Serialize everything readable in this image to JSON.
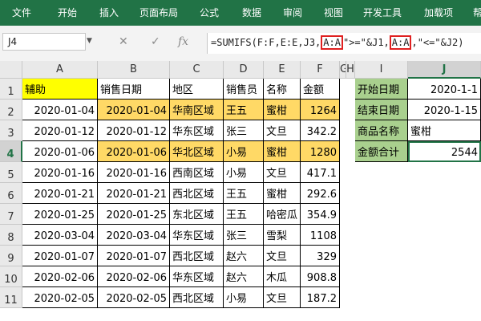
{
  "ribbon": {
    "tabs": [
      "文件",
      "开始",
      "插入",
      "页面布局",
      "公式",
      "数据",
      "审阅",
      "视图",
      "开发工具",
      "加载项",
      "帮"
    ]
  },
  "formula_bar": {
    "name_box": "J4",
    "cancel_symbol": "✕",
    "enter_symbol": "✓",
    "fx_symbol": "fx",
    "formula_parts": [
      "=SUMIFS(F:F,E:E,J3,",
      "A:A",
      ">=\"&J1,",
      "A:A",
      ",\"<=\"&J2)"
    ]
  },
  "grid": {
    "columns": [
      "A",
      "B",
      "C",
      "D",
      "E",
      "F",
      "G",
      "H",
      "I",
      "J"
    ],
    "rows": [
      "1",
      "2",
      "3",
      "4",
      "5",
      "6",
      "7",
      "8",
      "9",
      "10",
      "11"
    ],
    "active_cell": "J4",
    "header_row": [
      "辅助",
      "销售日期",
      "地区",
      "销售员",
      "名称",
      "金额"
    ],
    "records": [
      [
        "2020-01-04",
        "2020-01-04",
        "华南区域",
        "王五",
        "蜜柑",
        "1264"
      ],
      [
        "2020-01-12",
        "2020-01-12",
        "华东区域",
        "张三",
        "文旦",
        "342.2"
      ],
      [
        "2020-01-06",
        "2020-01-06",
        "华北区域",
        "小易",
        "蜜柑",
        "1280"
      ],
      [
        "2020-01-16",
        "2020-01-16",
        "西南区域",
        "小易",
        "文旦",
        "417.1"
      ],
      [
        "2020-01-21",
        "2020-01-21",
        "西北区域",
        "王五",
        "蜜柑",
        "292.6"
      ],
      [
        "2020-01-25",
        "2020-01-25",
        "东北区域",
        "王五",
        "哈密瓜",
        "354.9"
      ],
      [
        "2020-03-04",
        "2020-03-04",
        "华东区域",
        "张三",
        "雪梨",
        "1108"
      ],
      [
        "2020-01-07",
        "2020-01-07",
        "西北区域",
        "赵六",
        "文旦",
        "329"
      ],
      [
        "2020-02-06",
        "2020-02-06",
        "华东区域",
        "赵六",
        "木瓜",
        "908.8"
      ],
      [
        "2020-02-05",
        "2020-02-05",
        "西北区域",
        "小易",
        "文旦",
        "187.2"
      ]
    ],
    "highlighted_record_rows": [
      0,
      2
    ],
    "criteria": [
      {
        "label": "开始日期",
        "value": "2020-1-1",
        "align": "right"
      },
      {
        "label": "结束日期",
        "value": "2020-1-15",
        "align": "right"
      },
      {
        "label": "商品名称",
        "value": "蜜柑",
        "align": "left"
      },
      {
        "label": "金额合计",
        "value": "2544",
        "align": "right"
      }
    ]
  },
  "colors": {
    "ribbon": "#217346",
    "header_fill": "#ffff00",
    "match_fill": "#ffd966",
    "criteria_fill": "#a9d08e",
    "formula_highlight": "#e02020"
  }
}
